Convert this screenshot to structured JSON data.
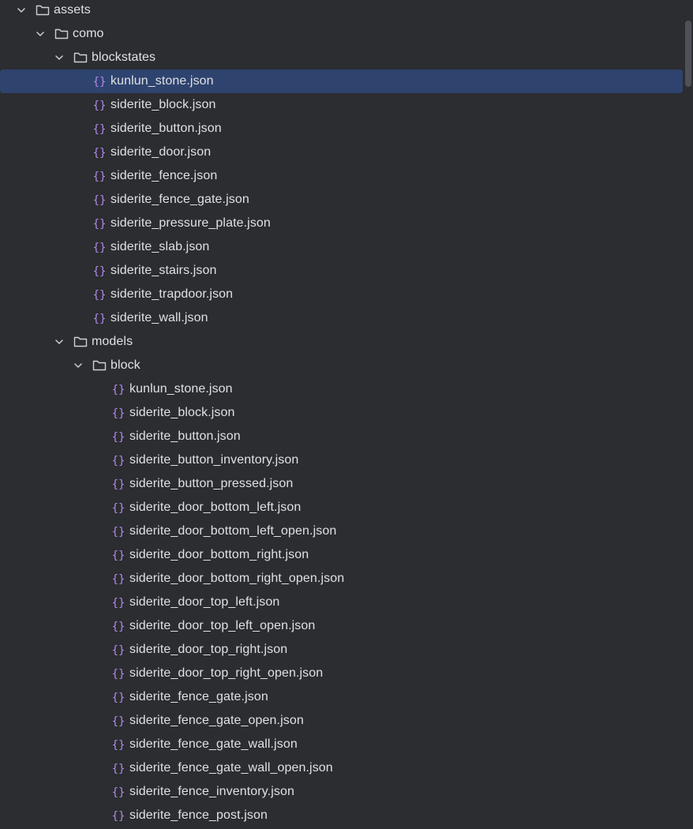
{
  "tree": {
    "nodes": [
      {
        "label": "assets",
        "type": "folder",
        "depth": 0,
        "expanded": true
      },
      {
        "label": "como",
        "type": "folder",
        "depth": 1,
        "expanded": true
      },
      {
        "label": "blockstates",
        "type": "folder",
        "depth": 2,
        "expanded": true
      },
      {
        "label": "kunlun_stone.json",
        "type": "json",
        "depth": 3,
        "selected": true
      },
      {
        "label": "siderite_block.json",
        "type": "json",
        "depth": 3
      },
      {
        "label": "siderite_button.json",
        "type": "json",
        "depth": 3
      },
      {
        "label": "siderite_door.json",
        "type": "json",
        "depth": 3
      },
      {
        "label": "siderite_fence.json",
        "type": "json",
        "depth": 3
      },
      {
        "label": "siderite_fence_gate.json",
        "type": "json",
        "depth": 3
      },
      {
        "label": "siderite_pressure_plate.json",
        "type": "json",
        "depth": 3
      },
      {
        "label": "siderite_slab.json",
        "type": "json",
        "depth": 3
      },
      {
        "label": "siderite_stairs.json",
        "type": "json",
        "depth": 3
      },
      {
        "label": "siderite_trapdoor.json",
        "type": "json",
        "depth": 3
      },
      {
        "label": "siderite_wall.json",
        "type": "json",
        "depth": 3
      },
      {
        "label": "models",
        "type": "folder",
        "depth": 2,
        "expanded": true
      },
      {
        "label": "block",
        "type": "folder",
        "depth": 3,
        "expanded": true
      },
      {
        "label": "kunlun_stone.json",
        "type": "json",
        "depth": 4
      },
      {
        "label": "siderite_block.json",
        "type": "json",
        "depth": 4
      },
      {
        "label": "siderite_button.json",
        "type": "json",
        "depth": 4
      },
      {
        "label": "siderite_button_inventory.json",
        "type": "json",
        "depth": 4
      },
      {
        "label": "siderite_button_pressed.json",
        "type": "json",
        "depth": 4
      },
      {
        "label": "siderite_door_bottom_left.json",
        "type": "json",
        "depth": 4
      },
      {
        "label": "siderite_door_bottom_left_open.json",
        "type": "json",
        "depth": 4
      },
      {
        "label": "siderite_door_bottom_right.json",
        "type": "json",
        "depth": 4
      },
      {
        "label": "siderite_door_bottom_right_open.json",
        "type": "json",
        "depth": 4
      },
      {
        "label": "siderite_door_top_left.json",
        "type": "json",
        "depth": 4
      },
      {
        "label": "siderite_door_top_left_open.json",
        "type": "json",
        "depth": 4
      },
      {
        "label": "siderite_door_top_right.json",
        "type": "json",
        "depth": 4
      },
      {
        "label": "siderite_door_top_right_open.json",
        "type": "json",
        "depth": 4
      },
      {
        "label": "siderite_fence_gate.json",
        "type": "json",
        "depth": 4
      },
      {
        "label": "siderite_fence_gate_open.json",
        "type": "json",
        "depth": 4
      },
      {
        "label": "siderite_fence_gate_wall.json",
        "type": "json",
        "depth": 4
      },
      {
        "label": "siderite_fence_gate_wall_open.json",
        "type": "json",
        "depth": 4
      },
      {
        "label": "siderite_fence_inventory.json",
        "type": "json",
        "depth": 4
      },
      {
        "label": "siderite_fence_post.json",
        "type": "json",
        "depth": 4
      }
    ]
  },
  "colors": {
    "background": "#2b2d30",
    "selection": "#2e436e",
    "text": "#dfe1e5",
    "json_icon": "#b589ec",
    "folder_icon": "#ced0d6",
    "chevron": "#ced0d6"
  },
  "icons": {
    "folder": "folder-icon",
    "json": "json-file-icon",
    "expanded": "chevron-down-icon"
  }
}
